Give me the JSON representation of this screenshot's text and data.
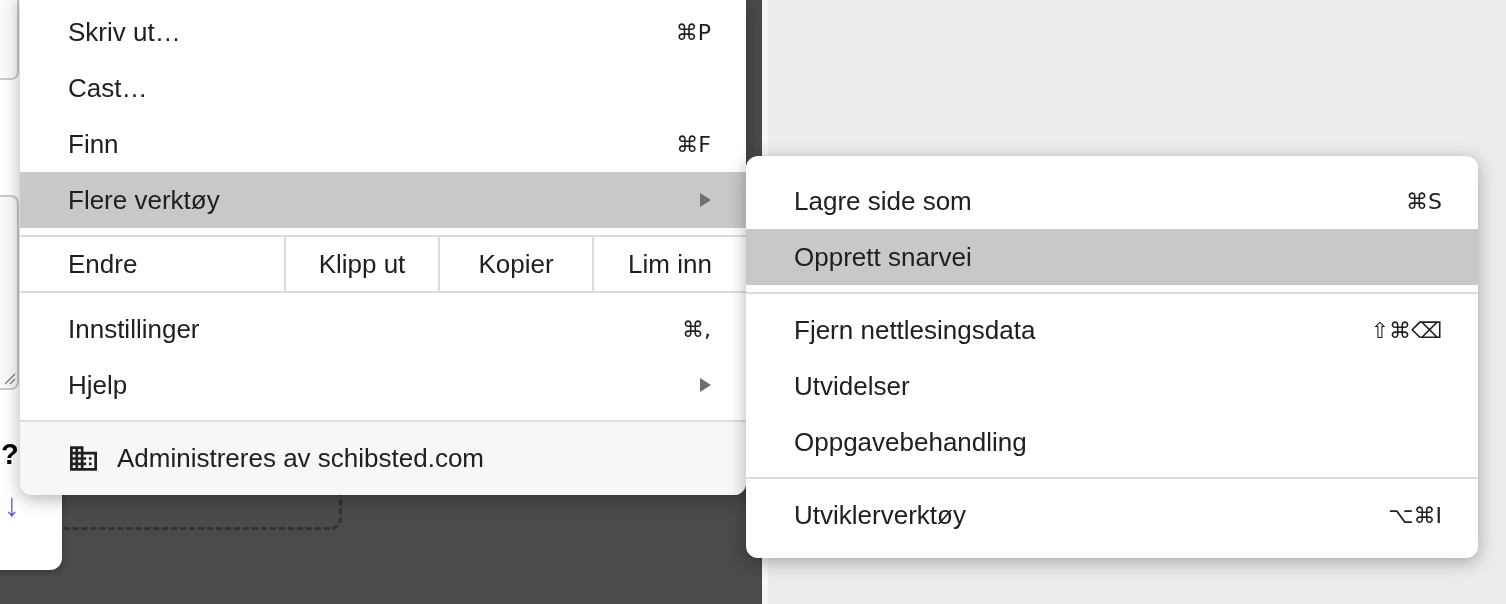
{
  "side_panel": {
    "heading": "?",
    "arrow": "↓"
  },
  "main_menu": {
    "groups": [
      {
        "kind": "list",
        "items": [
          {
            "label": "Skriv ut…",
            "shortcut": "⌘P",
            "submenu": false,
            "selected": false
          },
          {
            "label": "Cast…",
            "submenu": false,
            "selected": false
          },
          {
            "label": "Finn",
            "shortcut": "⌘F",
            "submenu": false,
            "selected": false
          },
          {
            "label": "Flere verktøy",
            "submenu": true,
            "selected": true
          }
        ]
      },
      {
        "kind": "edit",
        "label": "Endre",
        "actions": [
          "Klipp ut",
          "Kopier",
          "Lim inn"
        ]
      },
      {
        "kind": "list",
        "items": [
          {
            "label": "Innstillinger",
            "shortcut": "⌘,",
            "submenu": false,
            "selected": false
          },
          {
            "label": "Hjelp",
            "submenu": true,
            "selected": false
          }
        ]
      }
    ],
    "footer": {
      "text": "Administreres av schibsted.com"
    }
  },
  "submenu": {
    "groups": [
      {
        "kind": "list",
        "items": [
          {
            "label": "Lagre side som",
            "shortcut": "⌘S",
            "selected": false
          },
          {
            "label": "Opprett snarvei",
            "selected": true
          }
        ]
      },
      {
        "kind": "list",
        "items": [
          {
            "label": "Fjern nettlesingsdata",
            "shortcut": "⇧⌘⌫",
            "selected": false
          },
          {
            "label": "Utvidelser",
            "selected": false
          },
          {
            "label": "Oppgavebehandling",
            "selected": false
          }
        ]
      },
      {
        "kind": "list",
        "items": [
          {
            "label": "Utviklerverktøy",
            "shortcut": "⌥⌘I",
            "selected": false
          }
        ]
      }
    ]
  }
}
